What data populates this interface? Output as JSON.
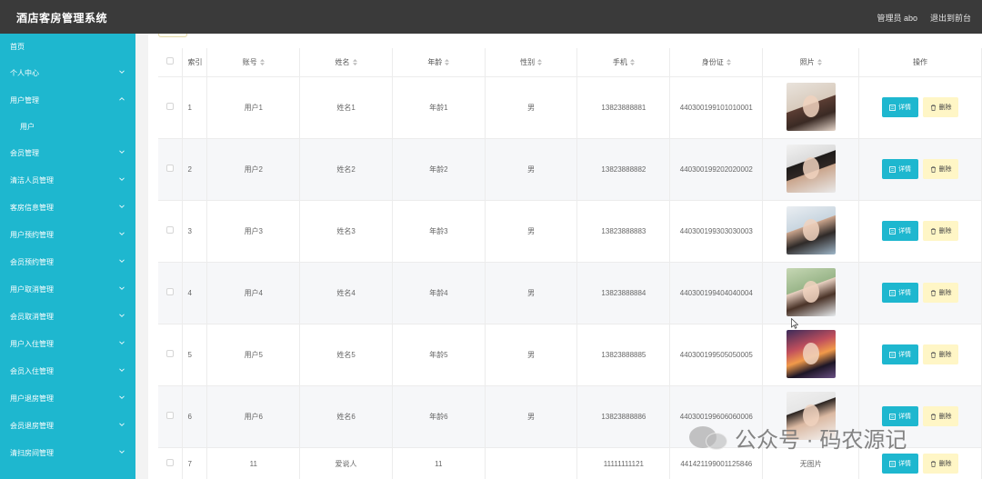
{
  "header": {
    "title": "酒店客房管理系统",
    "role_user": "管理员 abo",
    "back_link": "退出到前台"
  },
  "sidebar": {
    "items": [
      {
        "label": "首页",
        "has_chevron": false
      },
      {
        "label": "个人中心",
        "has_chevron": true
      },
      {
        "label": "用户管理",
        "has_chevron": true,
        "open": true
      },
      {
        "label": "用户",
        "sub": true
      },
      {
        "label": "会员管理",
        "has_chevron": true
      },
      {
        "label": "清洁人员管理",
        "has_chevron": true
      },
      {
        "label": "客房信息管理",
        "has_chevron": true
      },
      {
        "label": "用户预约管理",
        "has_chevron": true
      },
      {
        "label": "会员预约管理",
        "has_chevron": true
      },
      {
        "label": "用户取消管理",
        "has_chevron": true
      },
      {
        "label": "会员取消管理",
        "has_chevron": true
      },
      {
        "label": "用户入住管理",
        "has_chevron": true
      },
      {
        "label": "会员入住管理",
        "has_chevron": true
      },
      {
        "label": "用户退房管理",
        "has_chevron": true
      },
      {
        "label": "会员退房管理",
        "has_chevron": true
      },
      {
        "label": "清扫房间管理",
        "has_chevron": true
      }
    ]
  },
  "table": {
    "columns": [
      "索引",
      "账号",
      "姓名",
      "年龄",
      "性别",
      "手机",
      "身份证",
      "照片",
      "操作"
    ],
    "rows": [
      {
        "index": "1",
        "account": "用户1",
        "name": "姓名1",
        "age": "年龄1",
        "gender": "男",
        "phone": "13823888881",
        "id_card": "440300199101010001",
        "photo": "photo-1"
      },
      {
        "index": "2",
        "account": "用户2",
        "name": "姓名2",
        "age": "年龄2",
        "gender": "男",
        "phone": "13823888882",
        "id_card": "440300199202020002",
        "photo": "photo-2"
      },
      {
        "index": "3",
        "account": "用户3",
        "name": "姓名3",
        "age": "年龄3",
        "gender": "男",
        "phone": "13823888883",
        "id_card": "440300199303030003",
        "photo": "photo-3"
      },
      {
        "index": "4",
        "account": "用户4",
        "name": "姓名4",
        "age": "年龄4",
        "gender": "男",
        "phone": "13823888884",
        "id_card": "440300199404040004",
        "photo": "photo-4"
      },
      {
        "index": "5",
        "account": "用户5",
        "name": "姓名5",
        "age": "年龄5",
        "gender": "男",
        "phone": "13823888885",
        "id_card": "440300199505050005",
        "photo": "photo-5"
      },
      {
        "index": "6",
        "account": "用户6",
        "name": "姓名6",
        "age": "年龄6",
        "gender": "男",
        "phone": "13823888886",
        "id_card": "440300199606060006",
        "photo": "photo-6"
      },
      {
        "index": "7",
        "account": "11",
        "name": "爱说人",
        "age": "11",
        "gender": "",
        "phone": "11111111121",
        "id_card": "441421199001125846",
        "photo_text": "无图片"
      }
    ],
    "actions": {
      "detail": "详情",
      "delete": "删除"
    }
  },
  "watermark": {
    "text": "公众号 · 码农源记"
  },
  "colors": {
    "accent": "#1eb7cf",
    "header": "#3a3a3a",
    "delete_bg": "#fff6c6"
  }
}
